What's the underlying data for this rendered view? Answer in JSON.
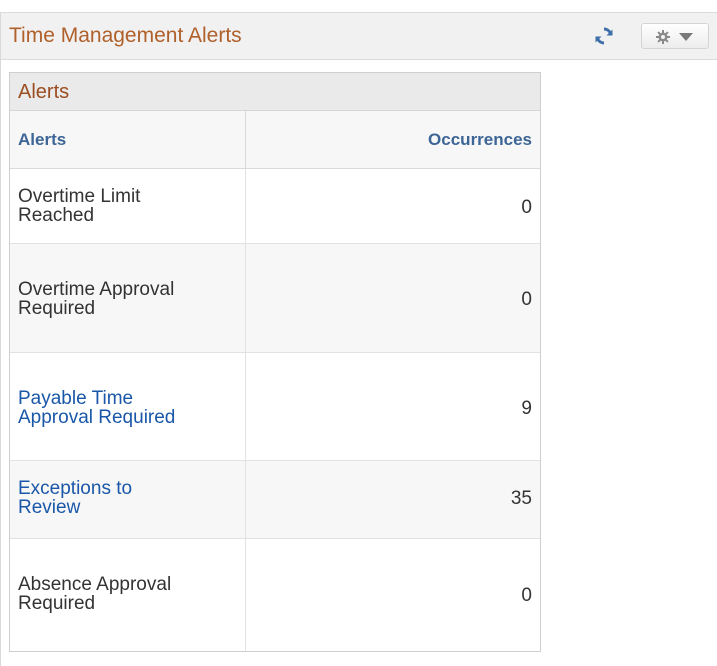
{
  "pagelet": {
    "title": "Time Management Alerts",
    "refresh_icon": "refresh-icon",
    "options_icon": "gear-icon"
  },
  "grid": {
    "caption": "Alerts",
    "columns": [
      "Alerts",
      "Occurrences"
    ],
    "rows": [
      {
        "line1": "Overtime Limit",
        "line2": "Reached",
        "count": "0",
        "is_link": false
      },
      {
        "line1": "Overtime Approval",
        "line2": "Required",
        "count": "0",
        "is_link": false
      },
      {
        "line1": "Payable Time",
        "line2": "Approval Required",
        "count": "9",
        "is_link": true
      },
      {
        "line1": "Exceptions to",
        "line2": "Review",
        "count": "35",
        "is_link": true
      },
      {
        "line1": "Absence Approval",
        "line2": "Required",
        "count": "0",
        "is_link": false
      }
    ]
  },
  "colors": {
    "title": "#b0602a",
    "column_header": "#3d6596",
    "link": "#1a57a8"
  }
}
